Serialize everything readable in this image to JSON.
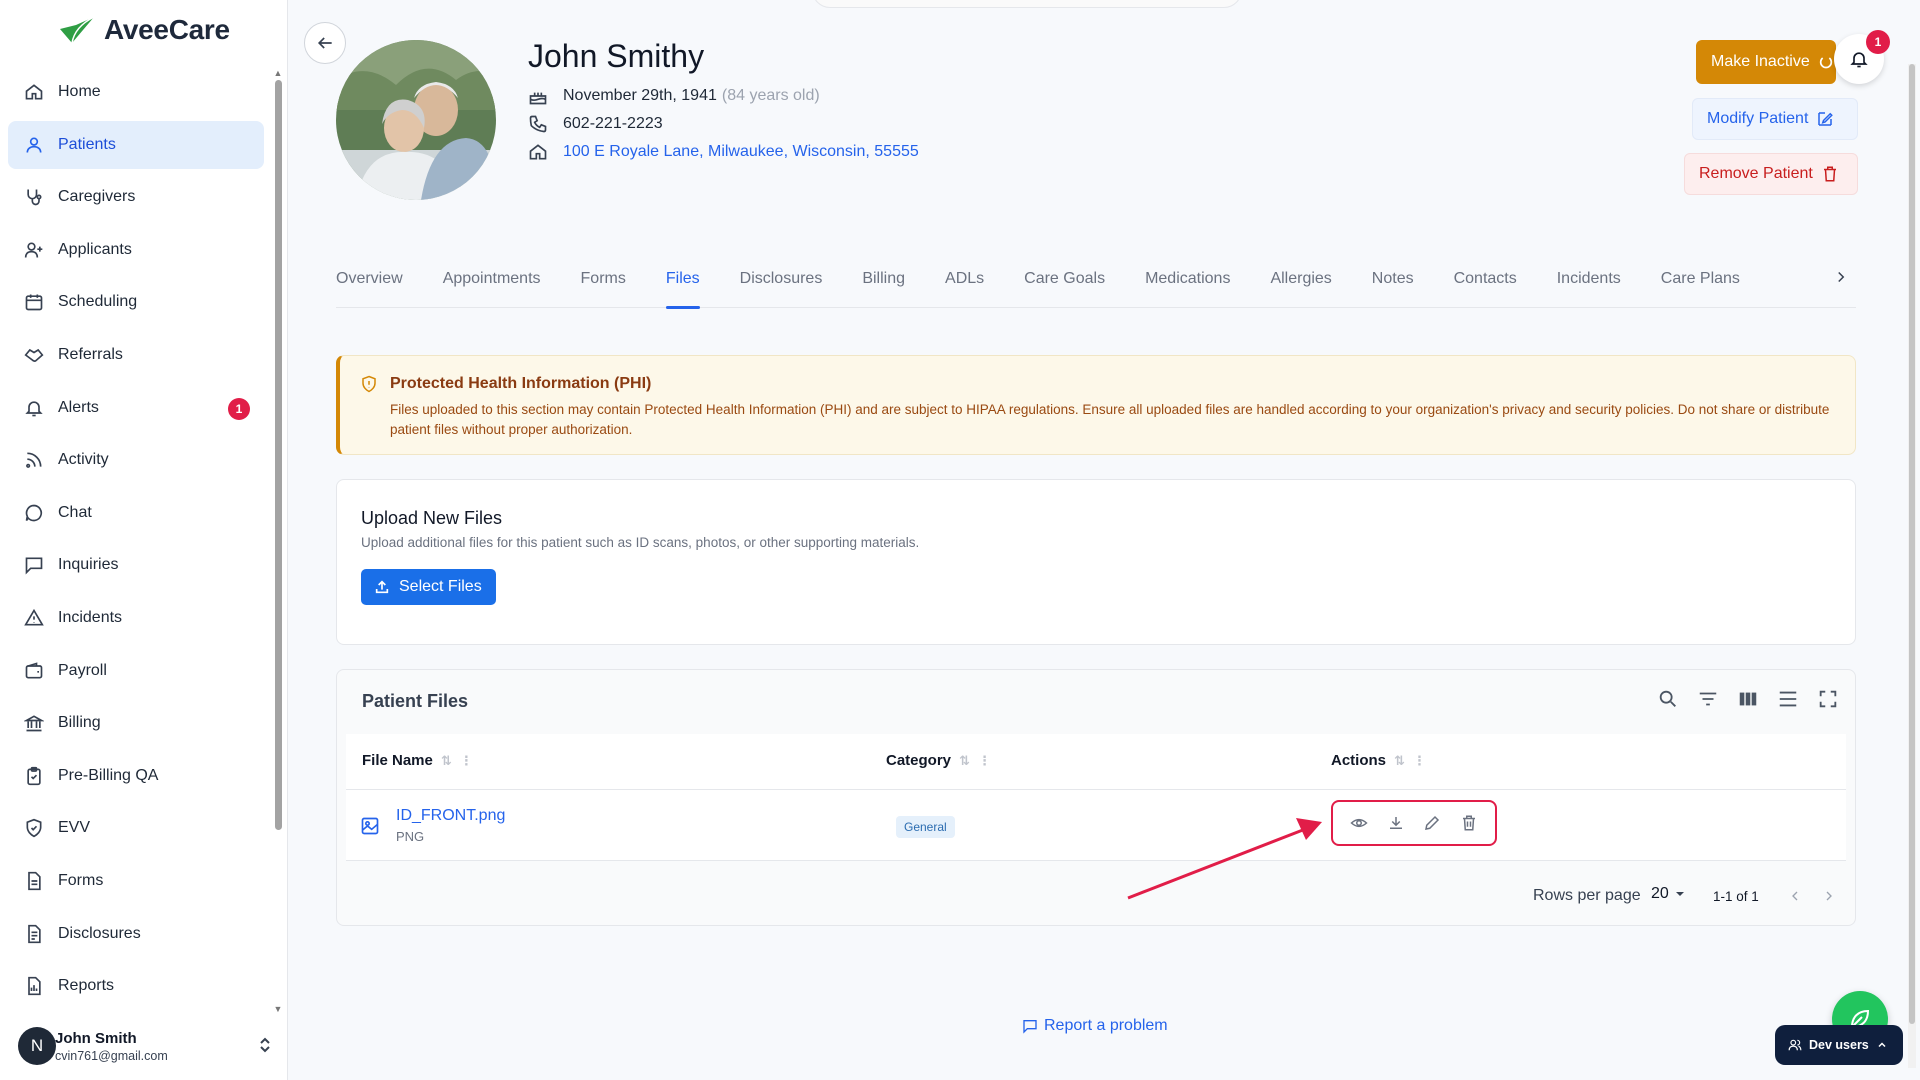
{
  "app": {
    "brand": "AveeCare",
    "brand_color": "#2f9e44"
  },
  "sidebar": {
    "items": [
      {
        "label": "Home",
        "icon": "home-icon"
      },
      {
        "label": "Patients",
        "icon": "user-icon",
        "active": true
      },
      {
        "label": "Caregivers",
        "icon": "stethoscope-icon"
      },
      {
        "label": "Applicants",
        "icon": "user-plus-icon"
      },
      {
        "label": "Scheduling",
        "icon": "calendar-icon"
      },
      {
        "label": "Referrals",
        "icon": "handshake-icon"
      },
      {
        "label": "Alerts",
        "icon": "bell-icon",
        "badge": "1"
      },
      {
        "label": "Activity",
        "icon": "rss-icon"
      },
      {
        "label": "Chat",
        "icon": "chat-bubble-icon"
      },
      {
        "label": "Inquiries",
        "icon": "message-square-icon"
      },
      {
        "label": "Incidents",
        "icon": "warning-triangle-icon"
      },
      {
        "label": "Payroll",
        "icon": "wallet-icon"
      },
      {
        "label": "Billing",
        "icon": "bank-icon"
      },
      {
        "label": "Pre-Billing QA",
        "icon": "clipboard-check-icon"
      },
      {
        "label": "EVV",
        "icon": "shield-check-icon"
      },
      {
        "label": "Forms",
        "icon": "document-icon"
      },
      {
        "label": "Disclosures",
        "icon": "document-text-icon"
      },
      {
        "label": "Reports",
        "icon": "file-chart-icon"
      }
    ],
    "user": {
      "initial": "N",
      "name": "John Smith",
      "email": "cvin761@gmail.com"
    }
  },
  "patient": {
    "name": "John Smithy",
    "dob": "November 29th, 1941",
    "age": "(84 years old)",
    "phone": "602-221-2223",
    "address": "100 E Royale Lane, Milwaukee, Wisconsin, 55555"
  },
  "header_actions": {
    "make_inactive": "Make Inactive",
    "modify": "Modify Patient",
    "remove": "Remove Patient",
    "notification_count": "1"
  },
  "tabs": [
    {
      "label": "Overview"
    },
    {
      "label": "Appointments"
    },
    {
      "label": "Forms"
    },
    {
      "label": "Files",
      "active": true
    },
    {
      "label": "Disclosures"
    },
    {
      "label": "Billing"
    },
    {
      "label": "ADLs"
    },
    {
      "label": "Care Goals"
    },
    {
      "label": "Medications"
    },
    {
      "label": "Allergies"
    },
    {
      "label": "Notes"
    },
    {
      "label": "Contacts"
    },
    {
      "label": "Incidents"
    },
    {
      "label": "Care Plans"
    }
  ],
  "phi_alert": {
    "title": "Protected Health Information (PHI)",
    "body": "Files uploaded to this section may contain Protected Health Information (PHI) and are subject to HIPAA regulations. Ensure all uploaded files are handled according to your organization's privacy and security policies. Do not share or distribute patient files without proper authorization."
  },
  "upload": {
    "title": "Upload New Files",
    "subtitle": "Upload additional files for this patient such as ID scans, photos, or other supporting materials.",
    "button": "Select Files"
  },
  "files_table": {
    "title": "Patient Files",
    "columns": [
      "File Name",
      "Category",
      "Actions"
    ],
    "rows": [
      {
        "name": "ID_FRONT.png",
        "type": "PNG",
        "category": "General"
      }
    ],
    "rows_per_page_label": "Rows per page",
    "rows_per_page": "20",
    "range": "1-1 of 1"
  },
  "footer": {
    "report": "Report a problem",
    "dev_users": "Dev users"
  },
  "colors": {
    "primary": "#2563eb",
    "warning": "#d48806",
    "danger": "#e11d48",
    "annotation": "#e11d48"
  }
}
